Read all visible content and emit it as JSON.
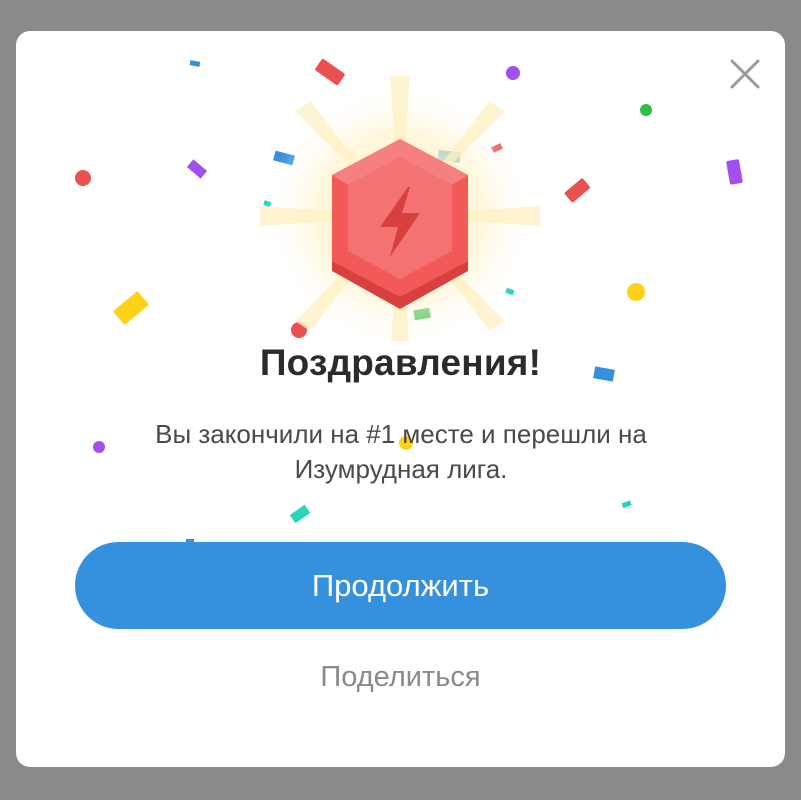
{
  "dialog": {
    "title": "Поздравления!",
    "message": "Вы закончили на #1 месте и перешли на Изумрудная лига.",
    "continue_label": "Продолжить",
    "share_label": "Поделиться"
  },
  "icons": {
    "close": "close-icon",
    "badge": "league-badge-icon",
    "lightning": "lightning-icon",
    "confetti": "confetti-decoration"
  },
  "colors": {
    "overlay": "#8a8a8a",
    "primary": "#3590de",
    "badge": "#f25a5a"
  }
}
